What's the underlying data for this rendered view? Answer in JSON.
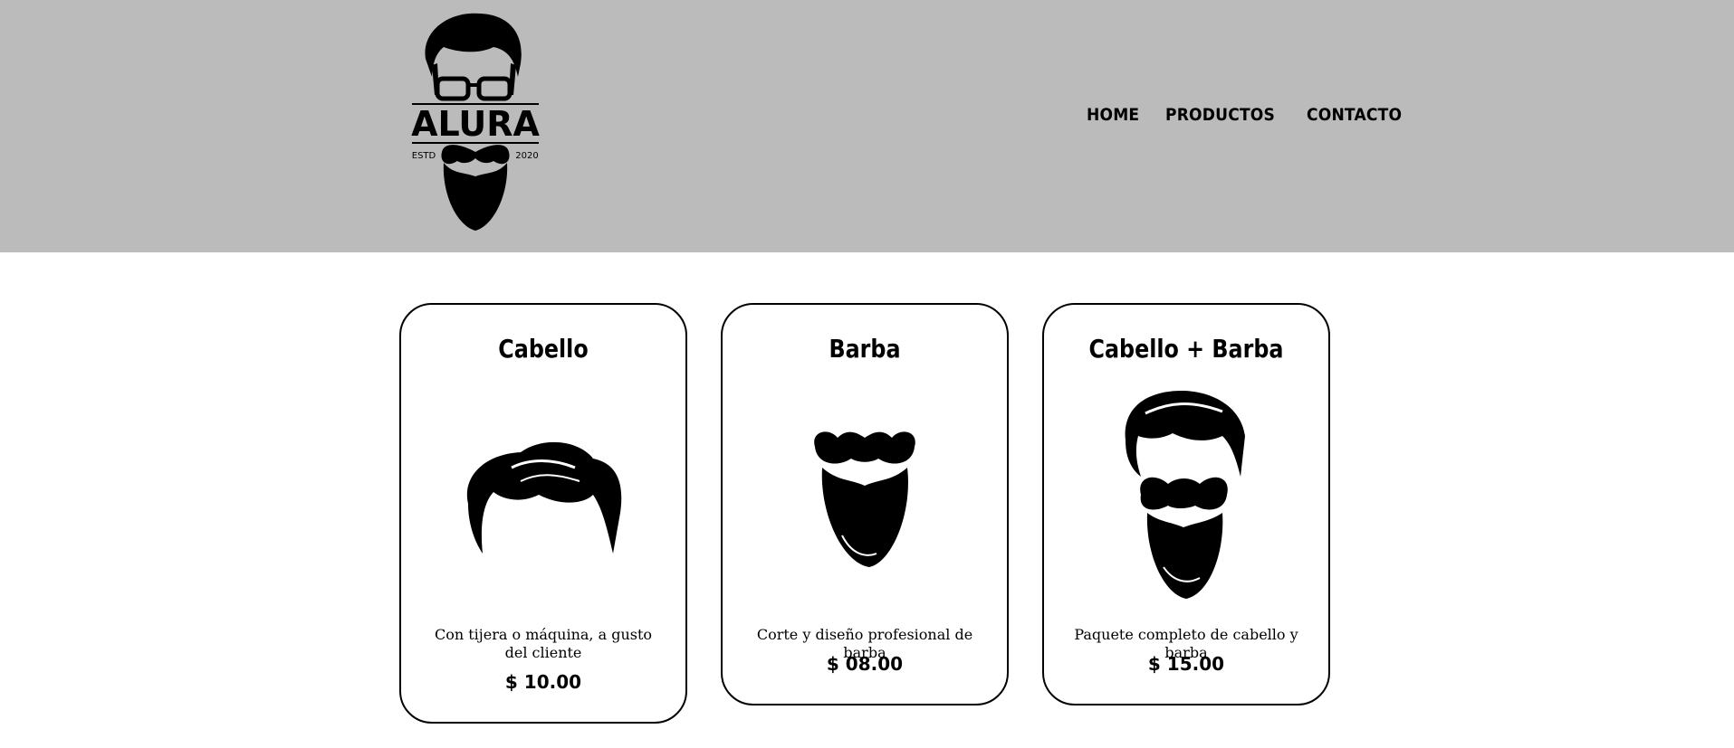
{
  "brand": {
    "logo_text": "ALURA",
    "logo_left": "ESTD",
    "logo_right": "2020"
  },
  "nav": {
    "items": [
      {
        "label": "HOME"
      },
      {
        "label": "PRODUCTOS"
      },
      {
        "label": "CONTACTO"
      }
    ]
  },
  "products": [
    {
      "title": "Cabello",
      "description": "Con tijera o máquina, a gusto del cliente",
      "price": "$ 10.00",
      "icon": "hair-icon"
    },
    {
      "title": "Barba",
      "description": "Corte y diseño profesional de barba",
      "price": "$ 08.00",
      "icon": "beard-icon"
    },
    {
      "title": "Cabello + Barba",
      "description": "Paquete completo de cabello y barba",
      "price": "$ 15.00",
      "icon": "hair-and-beard-icon"
    }
  ]
}
